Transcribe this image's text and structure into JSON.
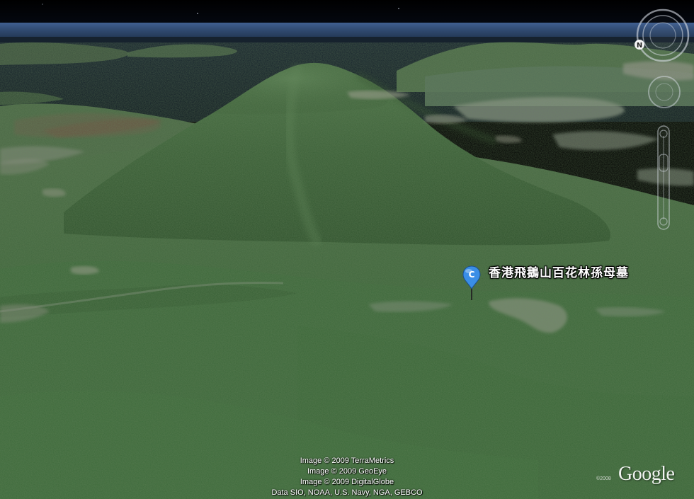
{
  "placemark": {
    "letter": "C",
    "label": "香港飛鵝山百花林孫母墓",
    "pin_color": "#3a8ee6"
  },
  "attribution": {
    "lines": [
      "Image © 2009 TerraMetrics",
      "Image © 2009 GeoEye",
      "Image © 2009 DigitalGlobe",
      "Data SIO, NOAA, U.S. Navy, NGA, GEBCO"
    ]
  },
  "logo": {
    "text": "Google",
    "copyright": "©2008"
  },
  "navigation": {
    "compass_north_label": "N",
    "icons": [
      "compass-ring-icon",
      "look-joystick-icon",
      "move-joystick-icon",
      "zoom-slider-icon"
    ]
  },
  "colors": {
    "sky": "#000000",
    "sea": "#1a2a3c",
    "forest": "#3f6a3c",
    "terrain_dark": "#2e4f2d"
  }
}
